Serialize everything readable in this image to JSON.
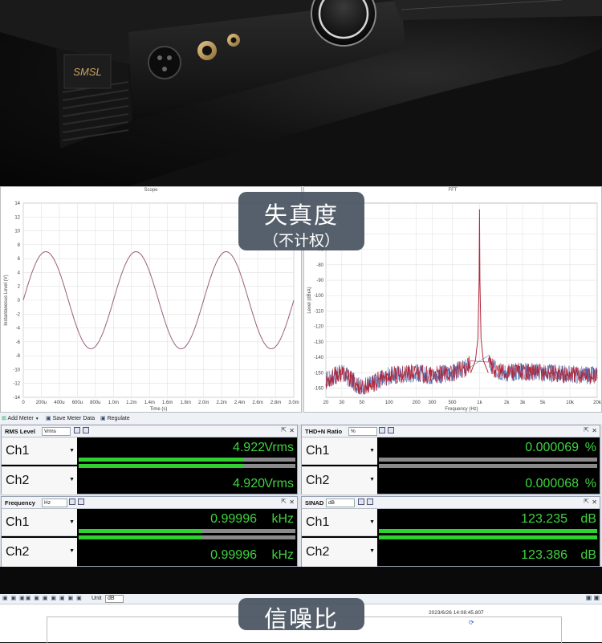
{
  "photo": {
    "brand_badge": "SMSL"
  },
  "overlay_top": {
    "title": "失真度",
    "subtitle": "（不计权）"
  },
  "scope": {
    "title": "Scope",
    "ylabel": "Instantaneous Level (V)",
    "xlabel": "Time (s)",
    "y_ticks": [
      "14",
      "12",
      "10",
      "8",
      "6",
      "4",
      "2",
      "0",
      "-2",
      "-4",
      "-6",
      "-8",
      "-10",
      "-12",
      "-14"
    ],
    "x_ticks": [
      "0",
      "200u",
      "400u",
      "600u",
      "800u",
      "1.0m",
      "1.2m",
      "1.4m",
      "1.6m",
      "1.8m",
      "2.0m",
      "2.2m",
      "2.4m",
      "2.6m",
      "2.8m",
      "3.0m"
    ]
  },
  "fft": {
    "title": "FFT",
    "ylabel": "Level (dBrA)",
    "xlabel": "Frequency (Hz)",
    "y_ticks": [
      "-50",
      "-60",
      "-70",
      "-80",
      "-90",
      "-100",
      "-110",
      "-120",
      "-130",
      "-140",
      "-150",
      "-160"
    ],
    "x_ticks": [
      "20",
      "30",
      "50",
      "100",
      "200",
      "300",
      "500",
      "1k",
      "2k",
      "3k",
      "5k",
      "10k",
      "20k"
    ]
  },
  "chart_data": [
    {
      "type": "line",
      "title": "Scope",
      "xlabel": "Time (s)",
      "ylabel": "Instantaneous Level (V)",
      "ylim": [
        -14,
        14
      ],
      "xlim": [
        0,
        0.003
      ],
      "series": [
        {
          "x": [
            0,
            0.00025,
            0.0005,
            0.00075,
            0.001,
            0.00125,
            0.0015,
            0.00175,
            0.002,
            0.00225,
            0.0025,
            0.00275,
            0.003
          ],
          "values": [
            0,
            7,
            0,
            -7,
            0,
            7,
            0,
            -7,
            0,
            7,
            0,
            -7,
            0
          ]
        }
      ],
      "grid": true
    },
    {
      "type": "line",
      "title": "FFT",
      "xlabel": "Frequency (Hz)",
      "ylabel": "Level (dBrA)",
      "ylim": [
        -160,
        -50
      ],
      "xlim": [
        20,
        20000
      ],
      "x_scale": "log",
      "series": [
        {
          "x": [
            20,
            30,
            50,
            100,
            200,
            300,
            500,
            700,
            900,
            1000,
            1100,
            1500,
            2000,
            3000,
            5000,
            10000,
            20000
          ],
          "values": [
            -155,
            -150,
            -160,
            -152,
            -150,
            -152,
            -150,
            -147,
            -140,
            10,
            -140,
            -148,
            -150,
            -149,
            -150,
            -151,
            -152
          ]
        }
      ],
      "grid": true
    }
  ],
  "meter_toolbar": {
    "add_meter": "Add Meter",
    "save_meter_data": "Save Meter Data",
    "regulate": "Regulate"
  },
  "meters": {
    "rms": {
      "title": "RMS Level",
      "unit_select": "Vrms",
      "ch1_label": "Ch1",
      "ch2_label": "Ch2",
      "ch1_value": "4.922",
      "ch2_value": "4.920",
      "unit": "Vrms",
      "ch1_bar_fraction": 0.76,
      "ch2_bar_fraction": 0.76
    },
    "thd": {
      "title": "THD+N Ratio",
      "unit_select": "%",
      "ch1_label": "Ch1",
      "ch2_label": "Ch2",
      "ch1_value": "0.000069",
      "ch2_value": "0.000068",
      "unit": "%",
      "ch1_bar_fraction": 0.0,
      "ch2_bar_fraction": 0.0
    },
    "freq": {
      "title": "Frequency",
      "unit_select": "Hz",
      "ch1_label": "Ch1",
      "ch2_label": "Ch2",
      "ch1_value": "0.99996",
      "ch2_value": "0.99996",
      "unit": "kHz",
      "ch1_bar_fraction": 0.57,
      "ch2_bar_fraction": 0.57
    },
    "sinad": {
      "title": "SINAD",
      "unit_select": "dB",
      "ch1_label": "Ch1",
      "ch2_label": "Ch2",
      "ch1_value": "123.235",
      "ch2_value": "123.386",
      "unit": "dB",
      "ch1_bar_fraction": 1.0,
      "ch2_bar_fraction": 1.0
    }
  },
  "bottom": {
    "unit_label": "Unit",
    "unit_value": "dB",
    "timestamp": "2023/6/26 14:08:45.807",
    "overlay_title": "信噪比"
  },
  "colors": {
    "meter_green": "#3ed43e",
    "trace_red": "#b0283c",
    "trace_blue": "#3a5fb0",
    "overlay_pill": "#485260"
  }
}
